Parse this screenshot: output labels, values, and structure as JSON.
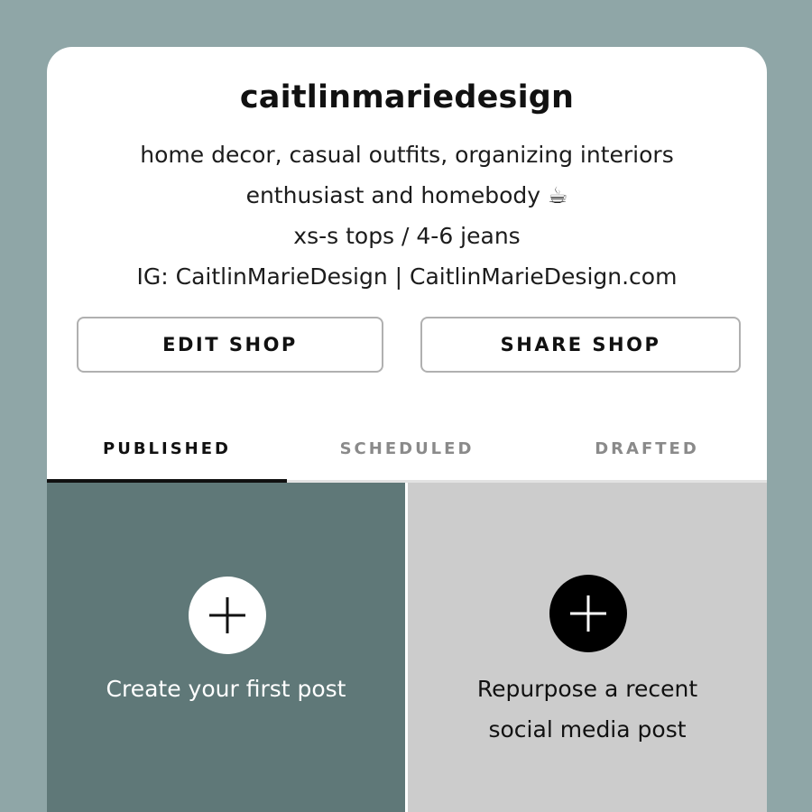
{
  "profile": {
    "username": "caitlinmariedesign",
    "bio_lines": [
      "home decor, casual outfits, organizing interiors",
      "enthusiast and homebody ☕",
      "xs-s tops / 4-6 jeans",
      "IG: CaitlinMarieDesign | CaitlinMarieDesign.com"
    ]
  },
  "actions": {
    "edit_label": "EDIT SHOP",
    "share_label": "SHARE SHOP"
  },
  "tabs": {
    "items": [
      {
        "label": "PUBLISHED",
        "active": true
      },
      {
        "label": "SCHEDULED",
        "active": false
      },
      {
        "label": "DRAFTED",
        "active": false
      }
    ]
  },
  "tiles": {
    "create": {
      "label": "Create your first post",
      "icon": "plus-icon"
    },
    "repurpose": {
      "label_line1": "Repurpose a recent",
      "label_line2": "social media post",
      "icon": "plus-icon"
    }
  },
  "colors": {
    "background": "#8fa6a7",
    "create_tile": "#5f7878",
    "repurpose_tile": "#cccccc"
  }
}
